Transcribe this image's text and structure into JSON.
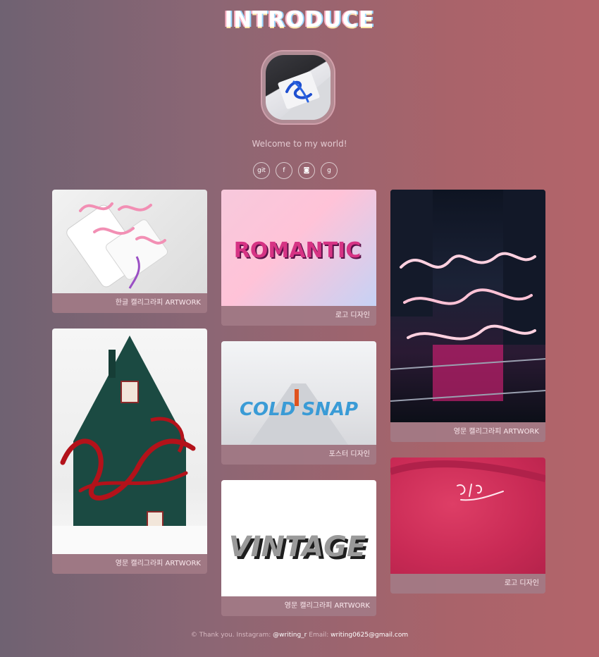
{
  "header": {
    "title": "INTRODUCE"
  },
  "profile": {
    "welcome": "Welcome to my world!"
  },
  "social": [
    {
      "label": "git",
      "icon": "git-icon"
    },
    {
      "label": "f",
      "icon": "facebook-icon"
    },
    {
      "label": "◙",
      "icon": "instagram-icon"
    },
    {
      "label": "g",
      "icon": "google-icon"
    }
  ],
  "gallery": [
    {
      "caption": "한글 캘리그라피 ARTWORK",
      "art": ""
    },
    {
      "caption": "영문 캘리그라피 ARTWORK",
      "art": "Beautiful"
    },
    {
      "caption": "로고 디자인",
      "art": "ROMANTIC"
    },
    {
      "caption": "포스터 디자인",
      "art": "COLD SNAP"
    },
    {
      "caption": "영문 캘리그라피 ARTWORK",
      "art": "VINTAGE"
    },
    {
      "caption": "영문 캘리그라피 ARTWORK",
      "art": "Wisdom counsel"
    },
    {
      "caption": "로고 디자인",
      "art": "기쁨"
    }
  ],
  "footer": {
    "thanks": "© Thank you. Instagram: ",
    "instagram": "@writing_r",
    "email_label": " Email: ",
    "email": "writing0625@gmail.com"
  },
  "colors": {
    "accent": "#b3646a",
    "base": "#6f6272"
  }
}
